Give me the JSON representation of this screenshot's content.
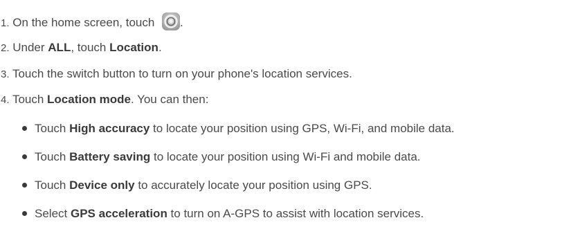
{
  "steps": [
    {
      "num": "1.",
      "pre": "On the home screen, touch",
      "post": "."
    },
    {
      "num": "2.",
      "pre": "Under ",
      "b1": "ALL",
      "mid": ", touch ",
      "b2": "Location",
      "post": "."
    },
    {
      "num": "3.",
      "text": "Touch the switch button to turn on your phone's location services."
    },
    {
      "num": "4.",
      "pre": "Touch ",
      "b1": "Location mode",
      "post": ". You can then:"
    }
  ],
  "bullets": [
    {
      "pre": "Touch ",
      "bold": "High accuracy",
      "post": " to locate your position using GPS, Wi-Fi, and mobile data."
    },
    {
      "pre": "Touch ",
      "bold": "Battery saving",
      "post": " to locate your position using Wi-Fi and mobile data."
    },
    {
      "pre": "Touch ",
      "bold": "Device only",
      "post": " to accurately locate your position using GPS."
    },
    {
      "pre": "Select ",
      "bold": "GPS acceleration",
      "post": " to turn on A-GPS to assist with location services."
    }
  ],
  "icons": {
    "settings": "settings-gear-icon"
  }
}
